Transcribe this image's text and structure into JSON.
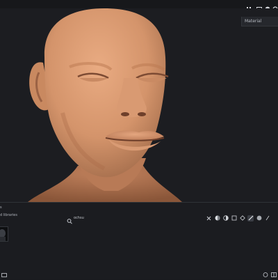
{
  "toolbar": {
    "icons": [
      "pause-icon",
      "frame-icon",
      "info-icon",
      "settings-icon"
    ]
  },
  "viewport": {
    "material_label": "Material"
  },
  "panel": {
    "title": "s",
    "subtitle": "d libraries",
    "search": {
      "value": "ochsu",
      "placeholder": ""
    },
    "filters": [
      "close-filter-icon",
      "sphere-filter-icon",
      "half-circle-filter-icon",
      "square-filter-icon",
      "diamond-filter-icon",
      "brush-filter-icon",
      "sphere-gray-filter-icon",
      "pen-filter-icon"
    ]
  }
}
